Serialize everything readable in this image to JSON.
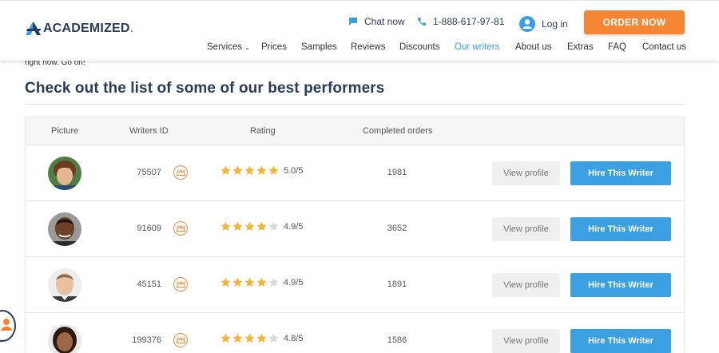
{
  "brand": {
    "logo_text": "ACADEMIZED",
    "logo_dot": ".",
    "accent": "#f58634",
    "link": "#3aa0e1",
    "dark": "#2a3b5a"
  },
  "header": {
    "chat_label": "Chat now",
    "phone_label": "1-888-617-97-81",
    "login_label": "Log in",
    "order_label": "ORDER NOW"
  },
  "nav": {
    "services": "Services",
    "prices": "Prices",
    "samples": "Samples",
    "reviews": "Reviews",
    "discounts": "Discounts",
    "our_writers": "Our writers",
    "about_us": "About us",
    "extras": "Extras",
    "faq": "FAQ",
    "contact_us": "Contact us"
  },
  "main": {
    "cut_text": "right now. Go on!",
    "heading": "Check out the list of some of our best performers"
  },
  "table": {
    "headers": {
      "picture": "Picture",
      "writers_id": "Writers ID",
      "rating": "Rating",
      "completed_orders": "Completed orders"
    },
    "view_label": "View profile",
    "hire_label": "Hire This Writer",
    "rows": [
      {
        "id": "75507",
        "stars": 5,
        "score": "5.0",
        "max": "/5",
        "orders": "1981"
      },
      {
        "id": "91609",
        "stars": 4,
        "score": "4.9",
        "max": "/5",
        "orders": "3652"
      },
      {
        "id": "45151",
        "stars": 4,
        "score": "4.9",
        "max": "/5",
        "orders": "1891"
      },
      {
        "id": "199376",
        "stars": 4,
        "score": "4.8",
        "max": "/5",
        "orders": "1586"
      }
    ]
  },
  "icons": {
    "chat": "chat-bubble-icon",
    "phone": "phone-icon",
    "user": "user-circle-icon",
    "crown": "crown-icon",
    "star": "star-icon"
  }
}
